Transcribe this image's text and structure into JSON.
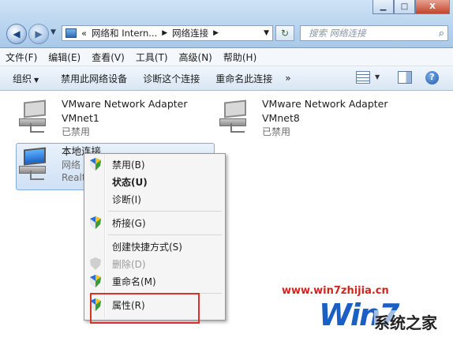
{
  "window": {
    "minimize_glyph": "▁",
    "maximize_glyph": "□",
    "close_glyph": "X"
  },
  "nav": {
    "back_glyph": "◀",
    "forward_glyph": "▶",
    "dropdown_glyph": "▼"
  },
  "address": {
    "prefix": "«",
    "crumb1": "网络和 Intern...",
    "sep": "▶",
    "crumb2": "网络连接",
    "dropdown_glyph": "▼"
  },
  "refresh_glyph": "↻",
  "search": {
    "placeholder": "搜索 网络连接",
    "icon_glyph": "⌕"
  },
  "menubar": {
    "items": [
      "文件(F)",
      "编辑(E)",
      "查看(V)",
      "工具(T)",
      "高级(N)",
      "帮助(H)"
    ]
  },
  "commandbar": {
    "organize": "组织",
    "arrow": "▼",
    "disable": "禁用此网络设备",
    "diagnose": "诊断这个连接",
    "rename": "重命名此连接",
    "more": "»",
    "help_glyph": "?"
  },
  "adapters": [
    {
      "name": "VMware Network Adapter",
      "name2": "VMnet1",
      "status": "已禁用"
    },
    {
      "name": "VMware Network Adapter",
      "name2": "VMnet8",
      "status": "已禁用"
    },
    {
      "name": "本地连接",
      "status": "网络",
      "device": "Realt"
    }
  ],
  "context_menu": {
    "items": [
      {
        "label": "禁用(B)"
      },
      {
        "label": "状态(U)"
      },
      {
        "label": "诊断(I)"
      },
      {
        "label": "桥接(G)"
      },
      {
        "label": "创建快捷方式(S)"
      },
      {
        "label": "删除(D)"
      },
      {
        "label": "重命名(M)"
      },
      {
        "label": "属性(R)"
      }
    ]
  },
  "watermark": {
    "url": "www.win7zhijia.cn",
    "logo": "Win7",
    "site": "系统之家"
  }
}
